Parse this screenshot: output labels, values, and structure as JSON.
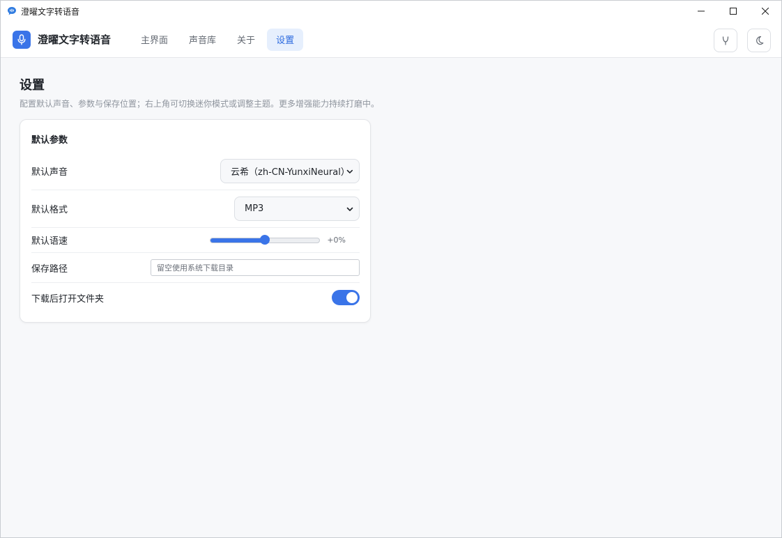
{
  "window": {
    "title": "澄曜文字转语音",
    "icon": "chat-bubble-icon"
  },
  "header": {
    "brand_name": "澄曜文字转语音",
    "brand_icon": "microphone-icon",
    "tabs": [
      {
        "label": "主界面",
        "active": false
      },
      {
        "label": "声音库",
        "active": false
      },
      {
        "label": "关于",
        "active": false
      },
      {
        "label": "设置",
        "active": true
      }
    ],
    "actions": [
      "mini-mode-icon",
      "moon-icon"
    ]
  },
  "page": {
    "title": "设置",
    "description": "配置默认声音、参数与保存位置；右上角可切换迷你模式或调整主题。更多增强能力持续打磨中。"
  },
  "card": {
    "title": "默认参数",
    "voice": {
      "label": "默认声音",
      "value": "云希（zh-CN-YunxiNeural）"
    },
    "format": {
      "label": "默认格式",
      "value": "MP3"
    },
    "rate": {
      "label": "默认语速",
      "value": "+0%",
      "fraction": 0.5
    },
    "path": {
      "label": "保存路径",
      "placeholder": "留空使用系统下载目录"
    },
    "open_folder": {
      "label": "下载后打开文件夹",
      "on": true
    }
  },
  "colors": {
    "accent": "#3a74e8",
    "tab_active_bg": "#e6effd"
  }
}
